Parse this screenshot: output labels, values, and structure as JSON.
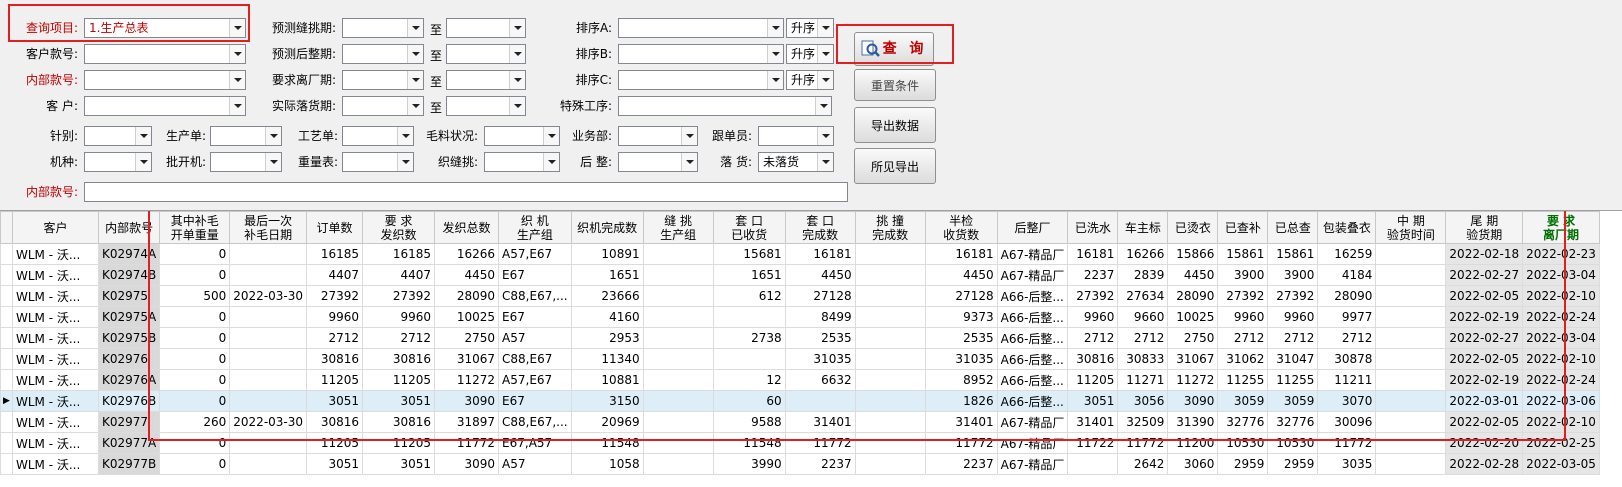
{
  "filters": {
    "query_item_label": "查询项目:",
    "query_item_value": "1.生产总表",
    "customer_no_label": "客户款号:",
    "internal_no_label": "内部款号:",
    "customer_label": "客 户:",
    "pred_sew_label": "预测缝挑期:",
    "pred_finish_label": "预测后整期:",
    "req_leave_label": "要求离厂期:",
    "actual_drop_label": "实际落货期:",
    "to_label": "至",
    "sort_a_label": "排序A:",
    "sort_b_label": "排序B:",
    "sort_c_label": "排序C:",
    "special_proc_label": "特殊工序:",
    "asc_label": "升序",
    "needle_label": "针别:",
    "prod_order_label": "生产单:",
    "craft_order_label": "工艺单:",
    "yarn_status_label": "毛料状况:",
    "business_label": "业务部:",
    "follower_label": "跟单员:",
    "machine_label": "机种:",
    "batch_label": "批开机:",
    "weight_label": "重量表:",
    "sew_label": "织缝挑:",
    "finish_label": "后 整:",
    "drop_label": "落 货:",
    "drop_value": "未落货",
    "internal_no2_label": "内部款号:"
  },
  "buttons": {
    "query": "查 询",
    "reset": "重置条件",
    "export": "导出数据",
    "export_visible": "所见导出"
  },
  "table": {
    "headers": [
      "客户",
      "内部款号",
      "其中补毛\n开单重量",
      "最后一次\n补毛日期",
      "订单数",
      "要 求\n发织数",
      "发织总数",
      "织 机\n生产组",
      "织机完成数",
      "缝 挑\n生产组",
      "套 口\n已收货",
      "套 口\n完成数",
      "挑 撞\n完成数",
      "半检\n收货数",
      "后整厂",
      "已洗水",
      "车主标",
      "已烫衣",
      "已查补",
      "已总查",
      "包装叠衣",
      "中 期\n验货时间",
      "尾 期\n验货期",
      "要 求\n离厂期"
    ],
    "rows": [
      [
        "WLM - 沃...",
        "K02974A",
        "0",
        "",
        "16185",
        "16185",
        "16266",
        "A57,E67",
        "10891",
        "",
        "15681",
        "16181",
        "",
        "16181",
        "A67-精品厂",
        "16181",
        "16266",
        "15866",
        "15861",
        "15861",
        "16259",
        "",
        "2022-02-18",
        "2022-02-23"
      ],
      [
        "WLM - 沃...",
        "K02974B",
        "0",
        "",
        "4407",
        "4407",
        "4450",
        "E67",
        "1651",
        "",
        "1651",
        "4450",
        "",
        "4450",
        "A67-精品厂",
        "2237",
        "2839",
        "4450",
        "3900",
        "3900",
        "4184",
        "",
        "2022-02-27",
        "2022-03-04"
      ],
      [
        "WLM - 沃...",
        "K02975",
        "500",
        "2022-03-30",
        "27392",
        "27392",
        "28090",
        "C88,E67,...",
        "23666",
        "",
        "612",
        "27128",
        "",
        "27128",
        "A66-后整...",
        "27392",
        "27634",
        "28090",
        "27392",
        "27392",
        "28090",
        "",
        "2022-02-05",
        "2022-02-10"
      ],
      [
        "WLM - 沃...",
        "K02975A",
        "0",
        "",
        "9960",
        "9960",
        "10025",
        "E67",
        "4160",
        "",
        "",
        "8499",
        "",
        "9373",
        "A66-后整...",
        "9960",
        "9660",
        "10025",
        "9960",
        "9960",
        "9977",
        "",
        "2022-02-19",
        "2022-02-24"
      ],
      [
        "WLM - 沃...",
        "K02975B",
        "0",
        "",
        "2712",
        "2712",
        "2750",
        "A57",
        "2953",
        "",
        "2738",
        "2535",
        "",
        "2535",
        "A66-后整...",
        "2712",
        "2712",
        "2750",
        "2712",
        "2712",
        "2712",
        "",
        "2022-02-27",
        "2022-03-04"
      ],
      [
        "WLM - 沃...",
        "K02976",
        "0",
        "",
        "30816",
        "30816",
        "31067",
        "C88,E67",
        "11340",
        "",
        "",
        "31035",
        "",
        "31035",
        "A66-后整...",
        "30816",
        "30833",
        "31067",
        "31062",
        "31047",
        "30878",
        "",
        "2022-02-05",
        "2022-02-10"
      ],
      [
        "WLM - 沃...",
        "K02976A",
        "0",
        "",
        "11205",
        "11205",
        "11272",
        "A57,E67",
        "10881",
        "",
        "12",
        "6632",
        "",
        "8952",
        "A66-后整...",
        "11205",
        "11271",
        "11272",
        "11255",
        "11255",
        "11211",
        "",
        "2022-02-19",
        "2022-02-24"
      ],
      [
        "WLM - 沃...",
        "K02976B",
        "0",
        "",
        "3051",
        "3051",
        "3090",
        "E67",
        "3150",
        "",
        "60",
        "",
        "",
        "1826",
        "A66-后整...",
        "3051",
        "3056",
        "3090",
        "3059",
        "3059",
        "3070",
        "",
        "2022-03-01",
        "2022-03-06"
      ],
      [
        "WLM - 沃...",
        "K02977",
        "260",
        "2022-03-30",
        "30816",
        "30816",
        "31897",
        "C88,E67,...",
        "20969",
        "",
        "9588",
        "31401",
        "",
        "31401",
        "A67-精品厂",
        "31401",
        "32509",
        "31390",
        "32776",
        "32776",
        "30096",
        "",
        "2022-02-05",
        "2022-02-10"
      ],
      [
        "WLM - 沃...",
        "K02977A",
        "0",
        "",
        "11205",
        "11205",
        "11772",
        "E67,A57",
        "11548",
        "",
        "11548",
        "11772",
        "",
        "11772",
        "A67-精品厂",
        "11722",
        "11772",
        "11200",
        "10530",
        "10530",
        "11772",
        "",
        "2022-02-20",
        "2022-02-25"
      ],
      [
        "WLM - 沃...",
        "K02977B",
        "0",
        "",
        "3051",
        "3051",
        "3090",
        "A57",
        "1058",
        "",
        "3990",
        "2237",
        "",
        "2237",
        "A67-精品厂",
        "",
        "2642",
        "3060",
        "2959",
        "2959",
        "3035",
        "",
        "2022-02-28",
        "2022-03-05"
      ]
    ]
  }
}
